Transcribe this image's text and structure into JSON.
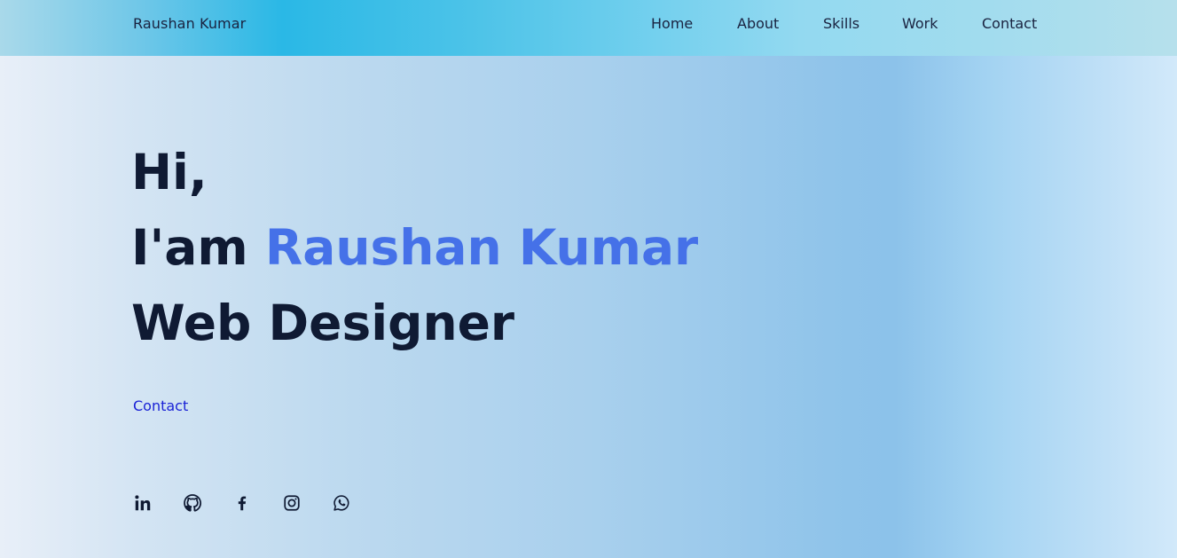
{
  "header": {
    "logo": "Raushan Kumar",
    "nav": [
      "Home",
      "About",
      "Skills",
      "Work",
      "Contact"
    ]
  },
  "hero": {
    "greeting": "Hi,",
    "intro_prefix": "I'am",
    "name": "Raushan Kumar",
    "role": "Web Designer",
    "contact_link": "Contact"
  },
  "social_icons": [
    "linkedin-icon",
    "github-icon",
    "facebook-icon",
    "instagram-icon",
    "whatsapp-icon"
  ],
  "colors": {
    "accent": "#4571e8",
    "heading": "#0f1a33",
    "link": "#1a22d6",
    "header_blue": "#2ab8e6"
  }
}
